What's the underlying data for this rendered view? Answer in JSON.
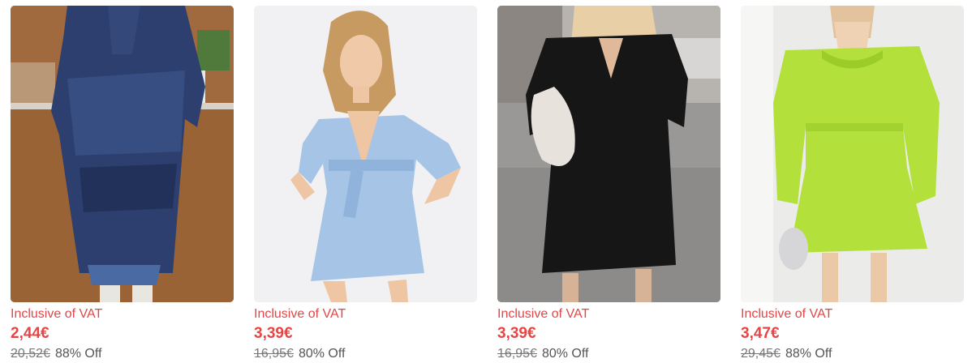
{
  "products": [
    {
      "image_icon": "blue-plaid-shirt-dress-photo",
      "vat_label": "Inclusive of VAT",
      "price": "2,44€",
      "original_price": "20,52€",
      "discount": "88% Off"
    },
    {
      "image_icon": "light-blue-wrap-dress-photo",
      "vat_label": "Inclusive of VAT",
      "price": "3,39€",
      "original_price": "16,95€",
      "discount": "80% Off"
    },
    {
      "image_icon": "black-v-neck-dress-photo",
      "vat_label": "Inclusive of VAT",
      "price": "3,39€",
      "original_price": "16,95€",
      "discount": "80% Off"
    },
    {
      "image_icon": "lime-green-puff-sleeve-dress-photo",
      "vat_label": "Inclusive of VAT",
      "price": "3,47€",
      "original_price": "29,45€",
      "discount": "88% Off"
    }
  ],
  "colors": {
    "price_red": "#e64545",
    "muted_text": "#777777"
  }
}
